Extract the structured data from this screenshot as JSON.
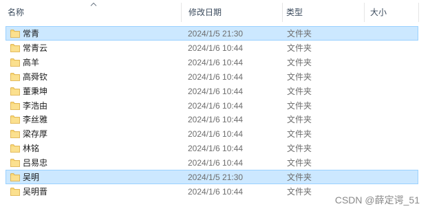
{
  "columns": {
    "name": "名称",
    "modified": "修改日期",
    "type": "类型",
    "size": "大小"
  },
  "sort": {
    "column": "name",
    "direction": "ascending"
  },
  "icon_folder": "folder-icon",
  "colors": {
    "selection_bg": "#cce8ff",
    "selection_border": "#99d1ff",
    "folder": "#f8d775"
  },
  "files": [
    {
      "name": "常青",
      "modified": "2024/1/5 21:30",
      "type": "文件夹",
      "selected": true
    },
    {
      "name": "常青云",
      "modified": "2024/1/6 10:44",
      "type": "文件夹",
      "selected": false
    },
    {
      "name": "高羊",
      "modified": "2024/1/6 10:44",
      "type": "文件夹",
      "selected": false
    },
    {
      "name": "高舜钦",
      "modified": "2024/1/6 10:44",
      "type": "文件夹",
      "selected": false
    },
    {
      "name": "董秉坤",
      "modified": "2024/1/6 10:44",
      "type": "文件夹",
      "selected": false
    },
    {
      "name": "李浩由",
      "modified": "2024/1/6 10:44",
      "type": "文件夹",
      "selected": false
    },
    {
      "name": "李丝雅",
      "modified": "2024/1/6 10:44",
      "type": "文件夹",
      "selected": false
    },
    {
      "name": "梁存厚",
      "modified": "2024/1/6 10:44",
      "type": "文件夹",
      "selected": false
    },
    {
      "name": "林铭",
      "modified": "2024/1/6 10:44",
      "type": "文件夹",
      "selected": false
    },
    {
      "name": "吕易忠",
      "modified": "2024/1/6 10:44",
      "type": "文件夹",
      "selected": false
    },
    {
      "name": "吴明",
      "modified": "2024/1/5 21:30",
      "type": "文件夹",
      "selected": true
    },
    {
      "name": "吴明晋",
      "modified": "2024/1/6 10:44",
      "type": "文件夹",
      "selected": false
    }
  ],
  "watermark": "CSDN @薛定谔_51"
}
